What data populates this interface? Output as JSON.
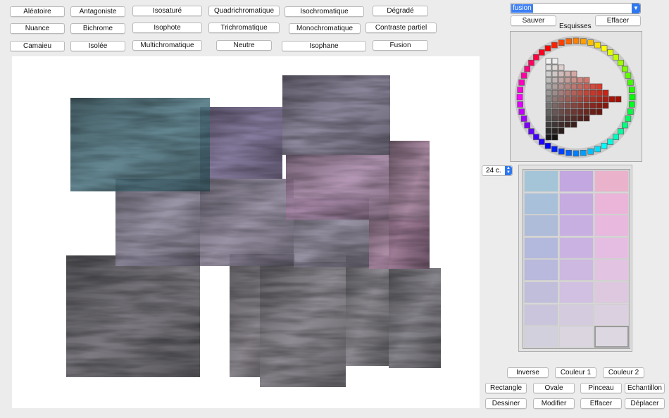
{
  "harmony_buttons": [
    "Aléatoire",
    "Antagoniste",
    "Isosaturé",
    "Quadrichromatique",
    "Isochromatique",
    "Dégradé",
    "Nuance",
    "Bichrome",
    "Isophote",
    "Trichromatique",
    "Monochromatique",
    "Contraste partiel",
    "Camaieu",
    "Isolée",
    "Multichromatique",
    "Neutre",
    "Isophane",
    "Fusion"
  ],
  "sketch": {
    "combo_value": "fusion",
    "save_label": "Sauver",
    "clear_label": "Effacer",
    "title": "Esquisses"
  },
  "colors_count": "24 c.",
  "colors": {
    "accent": "#2f78f0",
    "swatches": [
      [
        "#a4c5d8",
        "#c3a7e0",
        "#ebb2cc"
      ],
      [
        "#a9c0da",
        "#c6abe1",
        "#ebb5da"
      ],
      [
        "#aebcda",
        "#c8afe2",
        "#e8b8df"
      ],
      [
        "#b3b9dc",
        "#cab3e2",
        "#e6bde2"
      ],
      [
        "#b8b9dc",
        "#ccb8e1",
        "#e2c3e2"
      ],
      [
        "#c1bedc",
        "#d1c0e1",
        "#ddc8e0"
      ],
      [
        "#cac5dc",
        "#d5cbdf",
        "#dbd0e0"
      ],
      [
        "#d3d0dd",
        "#dad5df",
        "#dcd7e1"
      ]
    ],
    "selected_swatch": "#dcd7e1"
  },
  "action_buttons": {
    "inverse": "Inverse",
    "color1": "Couleur 1",
    "color2": "Couleur 2",
    "rectangle": "Rectangle",
    "oval": "Ovale",
    "brush": "Pinceau",
    "sample": "Echantillon",
    "draw": "Dessiner",
    "modify": "Modifier",
    "erase": "Effacer",
    "move": "Déplacer"
  }
}
